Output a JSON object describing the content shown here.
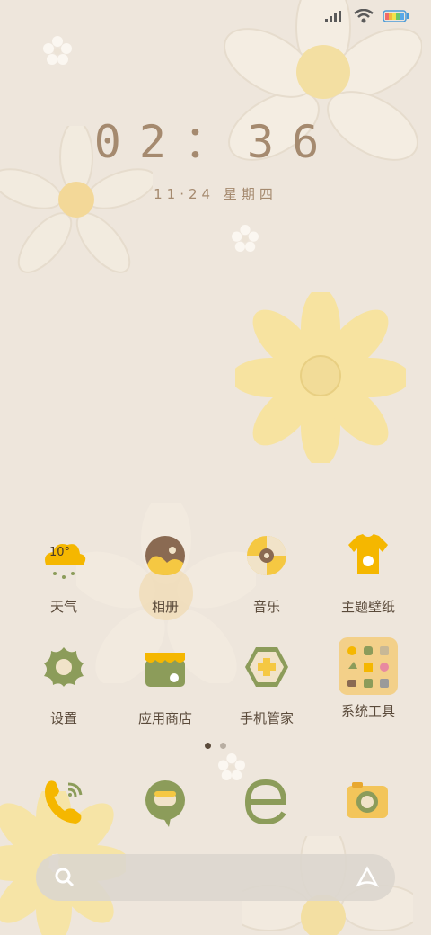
{
  "status": {
    "signal_icon": "signal-bars-icon",
    "wifi_icon": "wifi-icon",
    "battery_icon": "battery-icon"
  },
  "lockscreen": {
    "time": "02：36",
    "date": "11·24 星期四"
  },
  "apps": [
    {
      "name": "weather",
      "label": "天气",
      "icon": "weather-cloud-icon",
      "temp": "10°"
    },
    {
      "name": "gallery",
      "label": "相册",
      "icon": "gallery-icon"
    },
    {
      "name": "music",
      "label": "音乐",
      "icon": "music-disc-icon"
    },
    {
      "name": "themes",
      "label": "主题壁纸",
      "icon": "theme-shirt-icon"
    },
    {
      "name": "settings",
      "label": "设置",
      "icon": "settings-gear-icon"
    },
    {
      "name": "app-store",
      "label": "应用商店",
      "icon": "app-store-icon"
    },
    {
      "name": "phone-manager",
      "label": "手机管家",
      "icon": "security-shield-icon"
    },
    {
      "name": "system-tools",
      "label": "系统工具",
      "icon": "folder-icon"
    }
  ],
  "page_indicator": {
    "count": 2,
    "active": 1
  },
  "dock": [
    {
      "name": "phone",
      "icon": "phone-icon"
    },
    {
      "name": "messages",
      "icon": "message-icon"
    },
    {
      "name": "browser",
      "icon": "browser-icon"
    },
    {
      "name": "camera",
      "icon": "camera-icon"
    }
  ],
  "search": {
    "search_icon": "search-icon",
    "assistant_icon": "assistant-icon"
  },
  "colors": {
    "background": "#eee6dc",
    "yellow": "#f5c842",
    "green": "#8c9c5a",
    "brown": "#8a6a52",
    "text": "#5a4a3a"
  }
}
